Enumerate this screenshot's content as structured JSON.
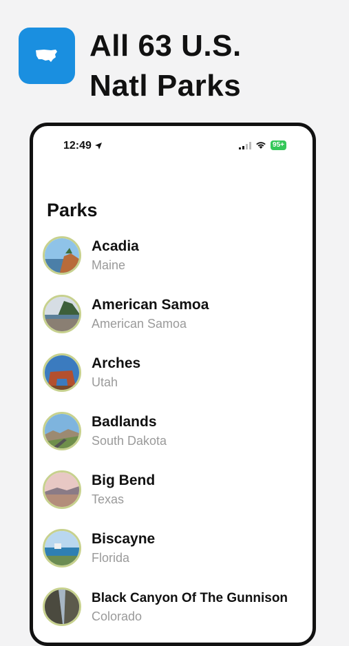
{
  "headline": {
    "line1": "All 63 U.S.",
    "line2": "Natl Parks"
  },
  "app_icon": {
    "icon": "usa-map-icon",
    "color": "#1a8fe0"
  },
  "status_bar": {
    "time": "12:49",
    "battery": "95+",
    "location_icon": "location-arrow-icon",
    "signal_icon": "signal-icon",
    "wifi_icon": "wifi-icon"
  },
  "list": {
    "title": "Parks",
    "parks": [
      {
        "name": "Acadia",
        "state": "Maine"
      },
      {
        "name": "American Samoa",
        "state": "American Samoa"
      },
      {
        "name": "Arches",
        "state": "Utah"
      },
      {
        "name": "Badlands",
        "state": "South Dakota"
      },
      {
        "name": "Big Bend",
        "state": "Texas"
      },
      {
        "name": "Biscayne",
        "state": "Florida"
      },
      {
        "name": "Black Canyon Of The Gunnison",
        "state": "Colorado"
      }
    ]
  },
  "colors": {
    "background": "#f3f3f4",
    "battery": "#34c759",
    "thumb_border": "#c7d18e",
    "subtitle": "#9a9a9a"
  }
}
